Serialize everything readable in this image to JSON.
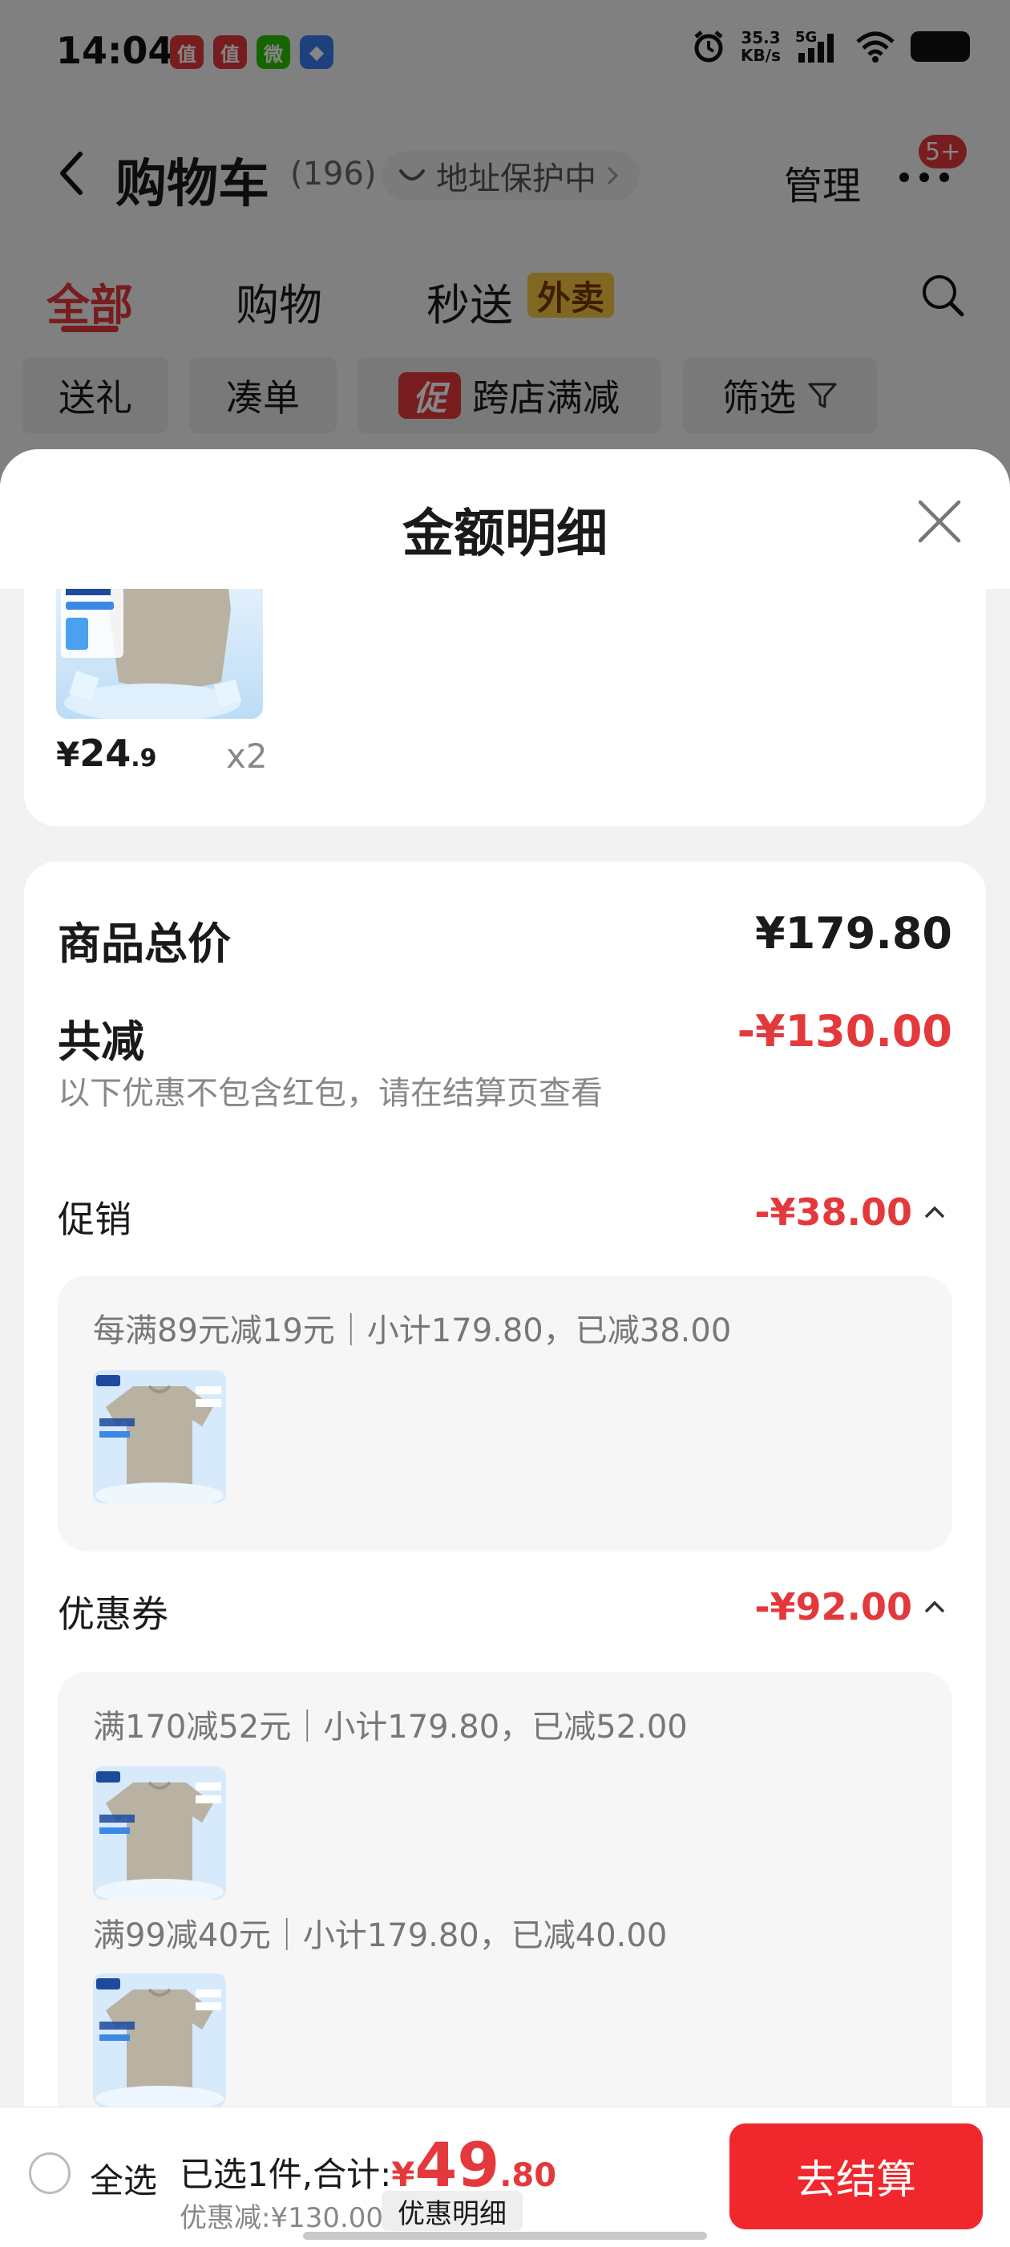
{
  "status_bar": {
    "time": "14:04",
    "apps": [
      {
        "label": "值",
        "color": "#e4393c"
      },
      {
        "label": "值",
        "color": "#e4393c"
      },
      {
        "label": "微",
        "color": "#2dc100"
      },
      {
        "label": "◆",
        "color": "#3b7bf0"
      }
    ],
    "net_speed_value": "35.3",
    "net_speed_unit": "KB/s",
    "network": "5G"
  },
  "header": {
    "title": "购物车",
    "count": "(196)",
    "address_protect": "地址保护中",
    "manage": "管理",
    "badge": "5+"
  },
  "tabs": [
    {
      "label": "全部",
      "active": true
    },
    {
      "label": "购物",
      "active": false
    },
    {
      "label": "秒送",
      "active": false
    }
  ],
  "waimai_tag": "外卖",
  "filter_chips": {
    "gift": "送礼",
    "bundle": "凑单",
    "promo_tag": "促",
    "cross_store": "跨店满减",
    "filter": "筛选"
  },
  "sheet": {
    "title": "金额明细",
    "product": {
      "price_symbol": "¥",
      "price_int": "24",
      "price_dec": ".9",
      "qty": "x2"
    },
    "total_label": "商品总价",
    "total_value": "¥179.80",
    "reduce_label": "共减",
    "reduce_value": "-¥130.00",
    "note": "以下优惠不包含红包，请在结算页查看",
    "promotion": {
      "label": "促销",
      "amount": "-¥38.00",
      "rules": [
        "每满89元减19元｜小计179.80，已减38.00"
      ]
    },
    "coupon": {
      "label": "优惠券",
      "amount": "-¥92.00",
      "rules": [
        "满170减52元｜小计179.80，已减52.00",
        "满99减40元｜小计179.80，已减40.00"
      ]
    }
  },
  "checkout": {
    "select_all": "全选",
    "selected_prefix": "已选1件,合计:",
    "total_symbol": "¥",
    "total_int": "49",
    "total_dec": ".80",
    "discount": "优惠减:¥130.00",
    "detail_button": "优惠明细",
    "checkout_button": "去结算"
  },
  "colors": {
    "accent_red": "#e4393c",
    "checkout_red": "#f0282d",
    "tag_yellow": "#f5c842"
  }
}
